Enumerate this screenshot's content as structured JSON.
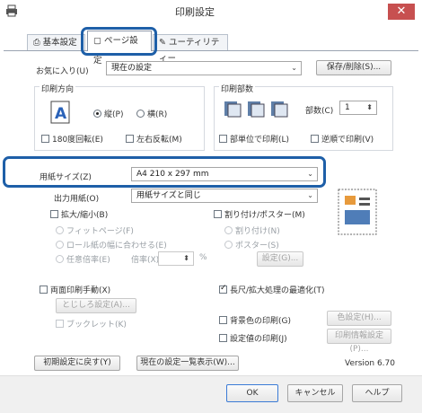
{
  "window": {
    "title": "印刷設定",
    "close_glyph": "✕"
  },
  "tabs": [
    {
      "label": "基本設定",
      "icon": "printer-icon"
    },
    {
      "label": "ページ設定",
      "icon": "page-icon",
      "active": true
    },
    {
      "label": "ユーティリティー",
      "icon": "tools-icon"
    }
  ],
  "favorites": {
    "label": "お気に入り(U)",
    "value": "現在の設定",
    "save_delete_label": "保存/削除(S)..."
  },
  "orientation": {
    "group_label": "印刷方向",
    "portrait_label": "縦(P)",
    "landscape_label": "横(R)",
    "selected": "portrait",
    "rotate180_label": "180度回転(E)",
    "mirror_label": "左右反転(M)"
  },
  "copies": {
    "group_label": "印刷部数",
    "copies_label": "部数(C)",
    "copies_value": "1",
    "collate_label": "部単位で印刷(L)",
    "reverse_label": "逆順で印刷(V)"
  },
  "paper": {
    "size_label": "用紙サイズ(Z)",
    "size_value": "A4 210 x 297 mm",
    "output_label": "出力用紙(O)",
    "output_value": "用紙サイズと同じ"
  },
  "scaling": {
    "enlarge_label": "拡大/縮小(B)",
    "fit_page_label": "フィットページ(F)",
    "roll_fit_label": "ロール紙の幅に合わせる(E)",
    "custom_label": "任意倍率(E)",
    "ratio_label": "倍率(X)",
    "unit": "%"
  },
  "layout": {
    "multipage_label": "割り付け/ポスター(M)",
    "nup_label": "割り付け(N)",
    "poster_label": "ポスター(S)",
    "settings_label": "設定(G)..."
  },
  "duplex": {
    "label": "両面印刷手動(X)",
    "margin_label": "とじしろ設定(A)...",
    "booklet_label": "ブックレット(K)"
  },
  "options": {
    "long_page_label": "長尺/拡大処理の最適化(T)",
    "bg_color_label": "背景色の印刷(G)",
    "color_settings_label": "色設定(H)...",
    "print_info_label": "設定値の印刷(J)",
    "info_settings_label": "印刷情報設定(P)..."
  },
  "footer": {
    "reset_label": "初期設定に戻す(Y)",
    "list_label": "現在の設定一覧表示(W)...",
    "version": "Version 6.70",
    "ok": "OK",
    "cancel": "キャンセル",
    "help": "ヘルプ"
  },
  "colors": {
    "highlight": "#1e5fa8",
    "close": "#c75050"
  }
}
